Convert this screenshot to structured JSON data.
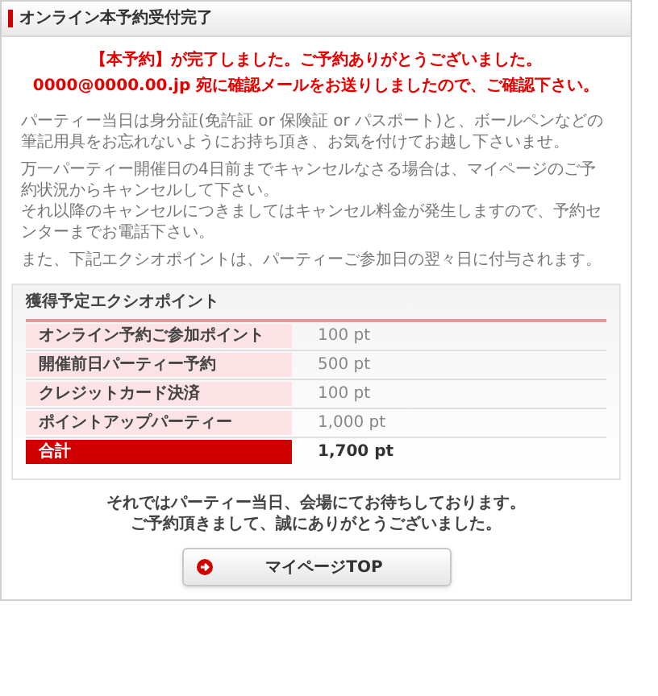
{
  "title": "オンライン本予約受付完了",
  "notice": [
    "【本予約】が完了しました。ご予約ありがとうございました。",
    "0000@0000.00.jp 宛に確認メールをお送りしましたので、ご確認下さい。"
  ],
  "paragraphs": [
    [
      "パーティー当日は身分証(免許証 or 保険証 or パスポート)と、ボールペンなどの筆記用具をお忘れないようにお持ち頂き、お気を付けてお越し下さいませ。"
    ],
    [
      "万一パーティー開催日の4日前までキャンセルなさる場合は、マイページのご予約状況からキャンセルして下さい。",
      "それ以降のキャンセルにつきましてはキャンセル料金が発生しますので、予約センターまでお電話下さい。"
    ],
    [
      "また、下記エクシオポイントは、パーティーご参加日の翌々日に付与されます。"
    ]
  ],
  "points": {
    "title": "獲得予定エクシオポイント",
    "rows": [
      {
        "kind": "item",
        "label": "オンライン予約ご参加ポイント",
        "value": "100 pt"
      },
      {
        "kind": "item",
        "label": "開催前日パーティー予約",
        "value": "500 pt"
      },
      {
        "kind": "item",
        "label": "クレジットカード決済",
        "value": "100 pt"
      },
      {
        "kind": "item",
        "label": "ポイントアップパーティー",
        "value": "1,000 pt"
      },
      {
        "kind": "total",
        "label": "合計",
        "value": "1,700 pt"
      }
    ]
  },
  "closing": [
    "それではパーティー当日、会場にてお待ちしております。",
    "ご予約頂きまして、誠にありがとうございました。"
  ],
  "button": "マイページTOP"
}
